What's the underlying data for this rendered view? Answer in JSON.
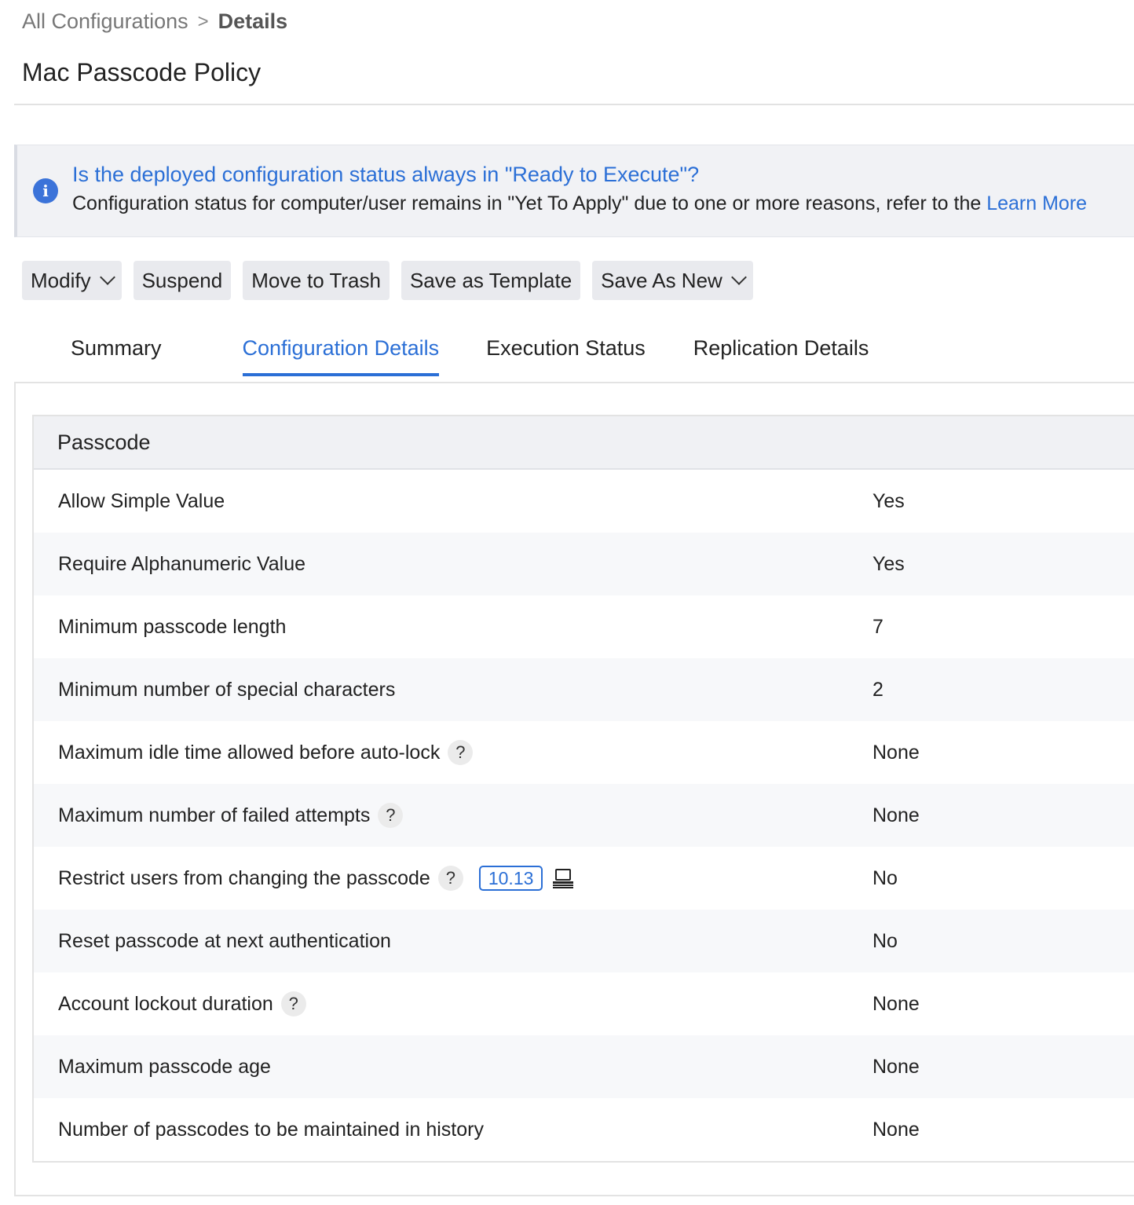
{
  "breadcrumb": {
    "parent": "All Configurations",
    "separator": ">",
    "current": "Details"
  },
  "page_title": "Mac Passcode Policy",
  "info_banner": {
    "question": "Is the deployed configuration status always in \"Ready to Execute\"?",
    "text": "Configuration status for computer/user remains in \"Yet To Apply\" due to one or more reasons, refer to the ",
    "link": "Learn More",
    "icon": "info-icon"
  },
  "toolbar": {
    "modify": "Modify",
    "suspend": "Suspend",
    "move_to_trash": "Move to Trash",
    "save_as_template": "Save as Template",
    "save_as_new": "Save As New"
  },
  "tabs": [
    {
      "label": "Summary"
    },
    {
      "label": "Configuration Details"
    },
    {
      "label": "Execution Status"
    },
    {
      "label": "Replication Details"
    }
  ],
  "active_tab": "Configuration Details",
  "section": {
    "title": "Passcode",
    "rows": [
      {
        "label": "Allow Simple Value",
        "value": "Yes"
      },
      {
        "label": "Require Alphanumeric Value",
        "value": "Yes"
      },
      {
        "label": "Minimum passcode length",
        "value": "7"
      },
      {
        "label": "Minimum number of special characters",
        "value": "2"
      },
      {
        "label": "Maximum idle time allowed before auto-lock",
        "value": "None",
        "help": "?"
      },
      {
        "label": "Maximum number of failed attempts",
        "value": "None",
        "help": "?"
      },
      {
        "label": "Restrict users from changing the passcode",
        "value": "No",
        "help": "?",
        "version": "10.13",
        "device_icon": "macbook-icon"
      },
      {
        "label": "Reset passcode at next authentication",
        "value": "No"
      },
      {
        "label": "Account lockout duration",
        "value": "None",
        "help": "?"
      },
      {
        "label": "Maximum passcode age",
        "value": "None"
      },
      {
        "label": "Number of passcodes to be maintained in history",
        "value": "None"
      }
    ]
  },
  "colors": {
    "accent": "#2b6fd6",
    "banner_bg": "#f1f2f5",
    "button_bg": "#e9eaee",
    "row_alt": "#f7f8fa"
  }
}
